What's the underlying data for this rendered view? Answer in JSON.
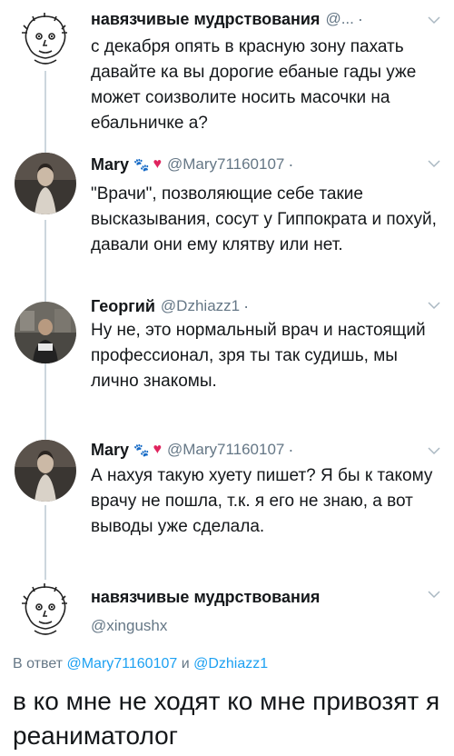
{
  "tweets": [
    {
      "name": "навязчивые мудрствования",
      "handle": "@...",
      "dot": "·",
      "text": "с декабря опять в красную зону пахать давайте ка вы дорогие ебаные гады уже может соизволите носить масочки на ебальничке а?"
    },
    {
      "name": "Mary",
      "emoji": "🐾",
      "heart": "♥",
      "handle": "@Mary71160107",
      "dot": "·",
      "text": "\"Врачи\", позволяющие себе такие высказывания, сосут у Гиппократа и похуй, давали они ему клятву или нет."
    },
    {
      "name": "Георгий",
      "handle": "@Dzhiazz1",
      "dot": "·",
      "text": "Ну не, это нормальный врач и настоящий профессионал, зря ты так судишь, мы лично знакомы."
    },
    {
      "name": "Mary",
      "emoji": "🐾",
      "heart": "♥",
      "handle": "@Mary71160107",
      "dot": "·",
      "text": "А нахуя такую хуету пишет? Я бы к такому врачу не пошла, т.к. я его не знаю, а вот выводы уже сделала."
    },
    {
      "name": "навязчивые мудрствования",
      "handle": "@xingushx"
    }
  ],
  "reply": {
    "prefix": "В ответ",
    "mention1": "@Mary71160107",
    "joiner": "и",
    "mention2": "@Dzhiazz1"
  },
  "main_text": "в ко мне не ходят ко мне привозят я реаниматолог"
}
